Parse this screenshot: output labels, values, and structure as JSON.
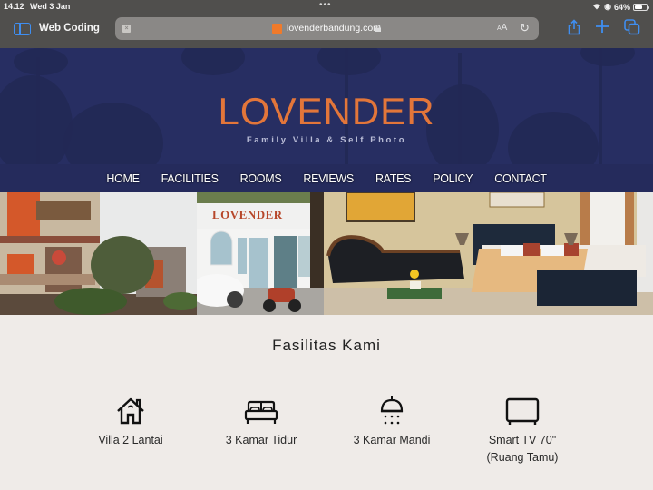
{
  "status_bar": {
    "time": "14.12",
    "date": "Wed 3 Jan",
    "battery": "64%",
    "battery_level": 0.64
  },
  "browser": {
    "tab_title": "Web Coding",
    "url": "lovenderbandung.com",
    "reader_label": "AA",
    "icons": {
      "sidebar": "sidebar-icon",
      "share": "share-icon",
      "new_tab": "plus-icon",
      "tabs": "tabs-icon",
      "reload": "reload-icon",
      "lock": "lock-icon"
    }
  },
  "site": {
    "logo": "LOVENDER",
    "tagline": "Family Villa & Self Photo",
    "nav": [
      "HOME",
      "FACILITIES",
      "ROOMS",
      "REVIEWS",
      "RATES",
      "POLICY",
      "CONTACT"
    ],
    "gallery_sign": "LOVENDER",
    "gallery": [
      "villa-exterior-photo",
      "villa-entrance-photo",
      "bedroom-photo"
    ]
  },
  "facilities": {
    "title": "Fasilitas Kami",
    "items": [
      {
        "icon": "house-icon",
        "label": "Villa 2 Lantai",
        "sub": ""
      },
      {
        "icon": "bed-icon",
        "label": "3 Kamar Tidur",
        "sub": ""
      },
      {
        "icon": "shower-icon",
        "label": "3 Kamar Mandi",
        "sub": ""
      },
      {
        "icon": "tv-icon",
        "label": "Smart TV 70\"",
        "sub": "(Ruang Tamu)"
      }
    ]
  },
  "colors": {
    "header_bg": "#272e62",
    "logo": "#e3763a",
    "accent": "#3f8ef0",
    "page_bg": "#efebe8"
  }
}
